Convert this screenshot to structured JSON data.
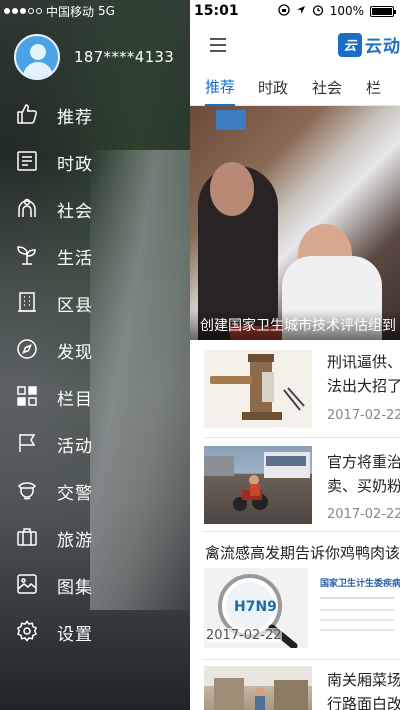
{
  "status_bar": {
    "carrier": "中国移动",
    "network": "5G",
    "time": "15:01",
    "battery": "100%",
    "battery_level": 1.0
  },
  "drawer": {
    "phone": "187****4133",
    "menu": [
      {
        "label": "推荐",
        "icon": "thumbs-up-icon"
      },
      {
        "label": "时政",
        "icon": "document-icon"
      },
      {
        "label": "社会",
        "icon": "people-icon"
      },
      {
        "label": "生活",
        "icon": "sprout-icon"
      },
      {
        "label": "区县",
        "icon": "building-icon"
      },
      {
        "label": "发现",
        "icon": "compass-icon"
      },
      {
        "label": "栏目",
        "icon": "grid-icon"
      },
      {
        "label": "活动",
        "icon": "flag-icon"
      },
      {
        "label": "交警",
        "icon": "police-icon"
      },
      {
        "label": "旅游",
        "icon": "luggage-icon"
      },
      {
        "label": "图集",
        "icon": "image-icon"
      },
      {
        "label": "设置",
        "icon": "gear-icon"
      }
    ]
  },
  "header": {
    "logo_badge": "云",
    "logo_text": "云动"
  },
  "tabs": [
    "推荐",
    "时政",
    "社会",
    "栏"
  ],
  "hero": {
    "caption": "创建国家卫生城市技术评估组到"
  },
  "news": [
    {
      "title_line1": "刑讯逼供、",
      "title_line2": "法出大招了",
      "date": "2017-02-22"
    },
    {
      "title_line1": "官方将重治",
      "title_line2": "卖、买奶粉",
      "date": "2017-02-22"
    },
    {
      "full_title": "禽流感高发期告诉你鸡鸭肉该",
      "date": "2017-02-22",
      "thumb_text": "H7N9",
      "doc_header": "国家卫生计生委疾病"
    },
    {
      "title_line1": "南关厢菜场",
      "title_line2": "行路面白改"
    }
  ],
  "colors": {
    "accent": "#1a6fc4",
    "avatar": "#4aa3e6"
  }
}
